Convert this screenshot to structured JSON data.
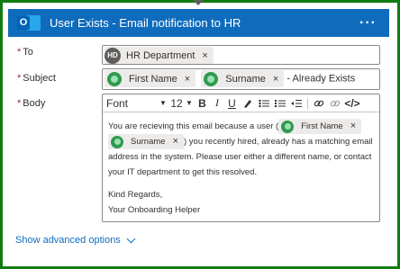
{
  "header": {
    "title": "User Exists - Email notification to HR",
    "more_label": "···"
  },
  "fields": {
    "to": {
      "label": "To",
      "required_mark": "*",
      "token": {
        "initials": "HD",
        "text": "HR Department",
        "remove": "×"
      }
    },
    "subject": {
      "label": "Subject",
      "required_mark": "*",
      "tokens": [
        {
          "text": "First Name",
          "remove": "×"
        },
        {
          "text": "Surname",
          "remove": "×"
        }
      ],
      "suffix": " - Already Exists"
    },
    "body": {
      "label": "Body",
      "required_mark": "*",
      "toolbar": {
        "font": "Font",
        "size": "12",
        "bold": "B",
        "italic": "I",
        "underline": "U"
      },
      "text_1": "You are recieving this email because a user (",
      "token_1": {
        "text": "First Name",
        "remove": "×"
      },
      "token_2": {
        "text": "Surname",
        "remove": "×"
      },
      "text_2": ") you recently hired, already has a matching email address in the system. Please user either a different name, or contact your IT department to get this resolved.",
      "sign_1": "Kind Regards,",
      "sign_2": "Your Onboarding Helper"
    }
  },
  "advanced": {
    "label": "Show advanced options"
  },
  "colors": {
    "border": "#107c10",
    "header": "#0f6cbd",
    "link": "#0f6cbd",
    "required": "#a4262c"
  }
}
